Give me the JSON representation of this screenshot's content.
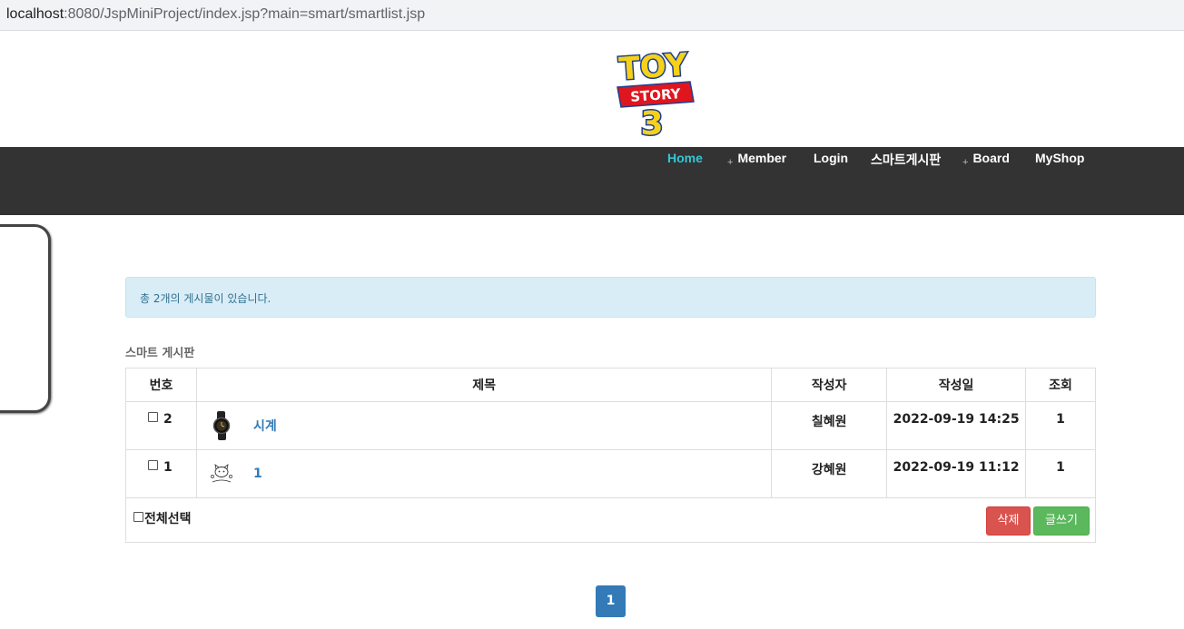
{
  "browser": {
    "url_host": "localhost",
    "url_rest": ":8080/JspMiniProject/index.jsp?main=smart/smartlist.jsp"
  },
  "logo": {
    "line1": "TOY",
    "line2": "STORY",
    "line3": "3"
  },
  "nav": {
    "items": [
      {
        "label": "Home",
        "active": true,
        "plus": false
      },
      {
        "label": "Member",
        "active": false,
        "plus": true
      },
      {
        "label": "Login",
        "active": false,
        "plus": false
      },
      {
        "label": "스마트게시판",
        "active": false,
        "plus": false
      },
      {
        "label": "Board",
        "active": false,
        "plus": true
      },
      {
        "label": "MyShop",
        "active": false,
        "plus": false
      }
    ],
    "plus_glyph": "+"
  },
  "alert": {
    "text": "총 2개의 게시물이 있습니다."
  },
  "board": {
    "title": "스마트 게시판",
    "columns": [
      "번호",
      "제목",
      "작성자",
      "작성일",
      "조회"
    ],
    "rows": [
      {
        "num": "2",
        "subject": "시계",
        "thumb_icon": "watch-icon",
        "writer": "칠혜원",
        "date": "2022-09-19 14:25",
        "views": "1"
      },
      {
        "num": "1",
        "subject": "1",
        "thumb_icon": "cat-sticker-icon",
        "writer": "강혜원",
        "date": "2022-09-19 11:12",
        "views": "1"
      }
    ],
    "select_all_label": "전체선택",
    "delete_label": "삭제",
    "write_label": "글쓰기"
  },
  "pagination": {
    "current": "1"
  },
  "colors": {
    "navbar": "#333333",
    "nav_active": "#35c6d6",
    "alert_bg": "#d9edf7",
    "link": "#337ab7",
    "danger": "#d9534f",
    "success": "#5cb85c"
  }
}
